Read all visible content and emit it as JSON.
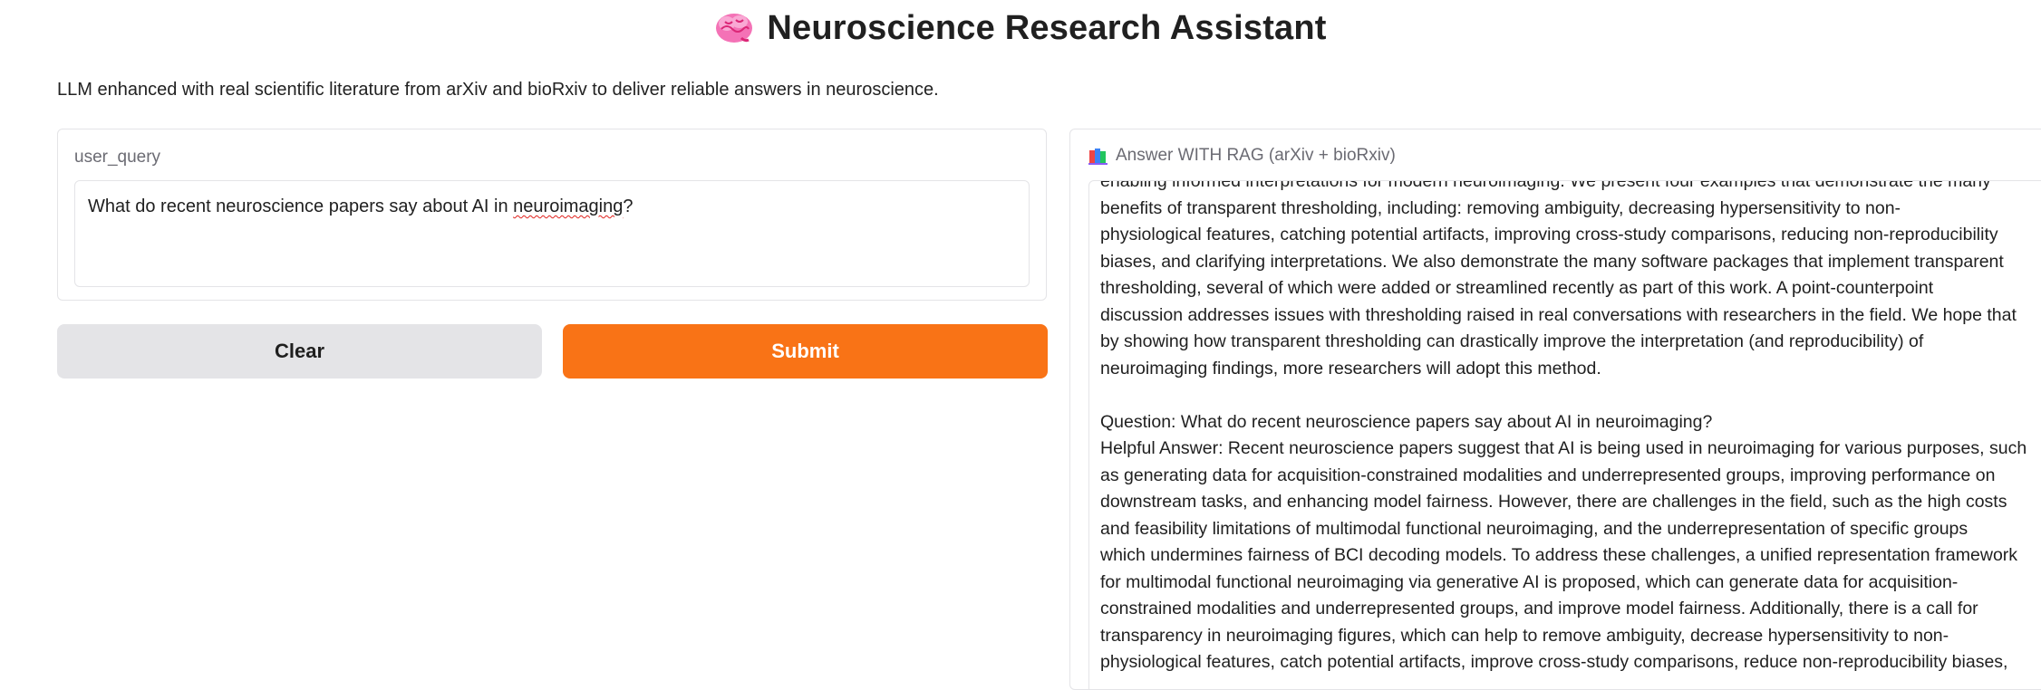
{
  "header": {
    "icon": "brain-icon",
    "title": "Neuroscience Research Assistant",
    "description": "LLM enhanced with real scientific literature from arXiv and bioRxiv to deliver reliable answers in neuroscience."
  },
  "query": {
    "label": "user_query",
    "value_before": "What do recent neuroscience papers say about AI in ",
    "value_misspelled": "neuroimaging",
    "value_after": "?"
  },
  "buttons": {
    "clear_label": "Clear",
    "submit_label": "Submit"
  },
  "answer": {
    "icon": "books-icon",
    "label": "Answer WITH RAG (arXiv + bioRxiv)",
    "lines": [
      "enabling informed interpretations for modern neuroimaging. We present four examples that demonstrate the many",
      "benefits of transparent thresholding, including: removing ambiguity, decreasing hypersensitivity to non-",
      "physiological features, catching potential artifacts, improving cross-study comparisons, reducing non-reproducibility",
      "biases, and clarifying interpretations. We also demonstrate the many software packages that implement transparent",
      "thresholding, several of which were added or streamlined recently as part of this work. A point-counterpoint",
      "discussion addresses issues with thresholding raised in real conversations with researchers in the field. We hope that",
      "by showing how transparent thresholding can drastically improve the interpretation (and reproducibility) of",
      "neuroimaging findings, more researchers will adopt this method.",
      "",
      "Question: What do recent neuroscience papers say about AI in neuroimaging?",
      "Helpful Answer: Recent neuroscience papers suggest that AI is being used in neuroimaging for various purposes, such",
      "as generating data for acquisition-constrained modalities and underrepresented groups, improving performance on",
      "downstream tasks, and enhancing model fairness. However, there are challenges in the field, such as the high costs",
      "and feasibility limitations of multimodal functional neuroimaging, and the underrepresentation of specific groups",
      "which undermines fairness of BCI decoding models. To address these challenges, a unified representation framework",
      "for multimodal functional neuroimaging via generative AI is proposed, which can generate data for acquisition-",
      "constrained modalities and underrepresented groups, and improve model fairness. Additionally, there is a call for",
      "transparency in neuroimaging figures, which can help to remove ambiguity, decrease hypersensitivity to non-",
      "physiological features, catch potential artifacts, improve cross-study comparisons, reduce non-reproducibility biases,"
    ]
  },
  "colors": {
    "submit": "#f97316",
    "clear": "#e4e4e7",
    "border": "#e4e4e7",
    "label": "#6b6b73"
  }
}
